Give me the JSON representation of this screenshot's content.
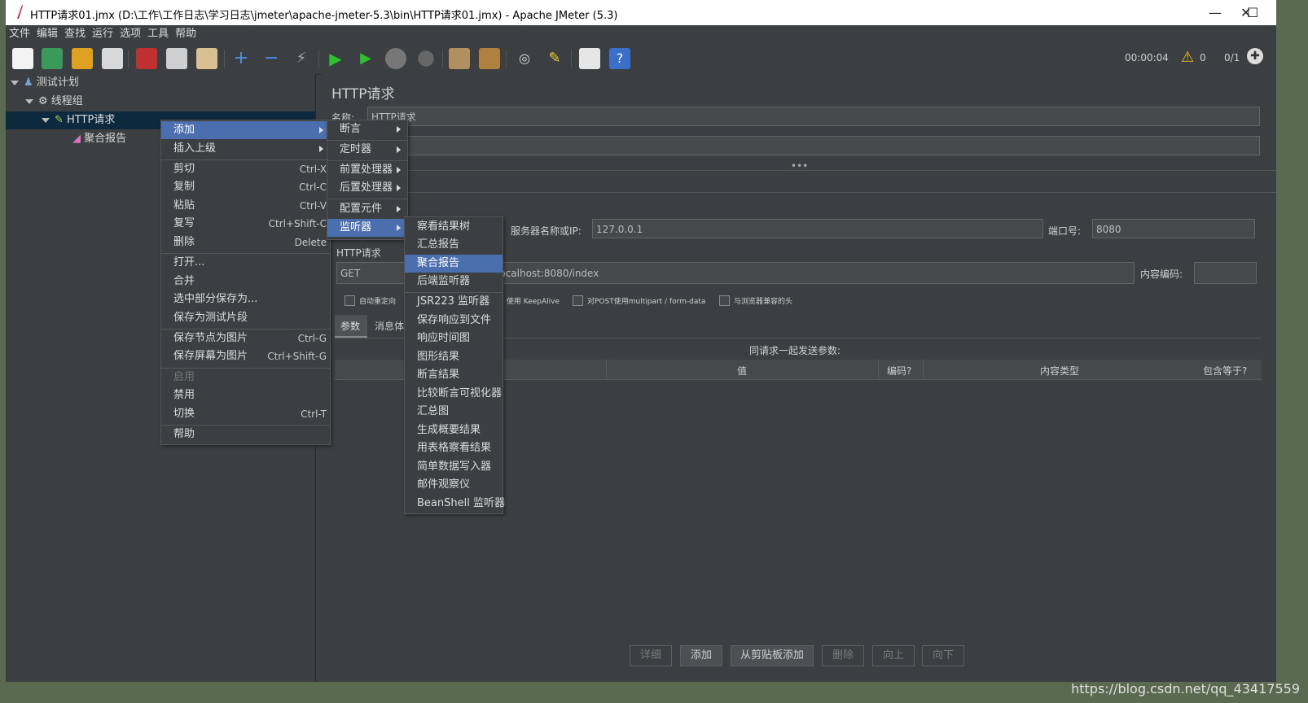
{
  "window": {
    "title": "HTTP请求01.jmx (D:\\工作\\工作日志\\学习日志\\jmeter\\apache-jmeter-5.3\\bin\\HTTP请求01.jmx) - Apache JMeter (5.3)",
    "min": "—",
    "max": "☐",
    "close": "✕"
  },
  "menubar": [
    "文件",
    "编辑",
    "查找",
    "运行",
    "选项",
    "工具",
    "帮助"
  ],
  "toolbar": {
    "timer": "00:00:04",
    "warnings": "0",
    "threads": "0/1"
  },
  "tree": {
    "items": [
      {
        "label": "测试计划"
      },
      {
        "label": "线程组"
      },
      {
        "label": "HTTP请求"
      },
      {
        "label": "聚合报告"
      }
    ]
  },
  "panel": {
    "title": "HTTP请求",
    "name_label": "名称:",
    "name_value": "HTTP请求",
    "server_label": "服务器名称或IP:",
    "server_value": "127.0.0.1",
    "port_label": "端口号:",
    "port_value": "8080",
    "http_section": "HTTP请求",
    "method": "GET",
    "path_value": "localhost:8080/index",
    "encoding_label": "内容编码:",
    "checks": [
      "自动重定向",
      "使用 KeepAlive",
      "对POST使用multipart / form-data",
      "与浏览器兼容的头"
    ],
    "tabs": [
      "参数",
      "消息体数据"
    ],
    "params_caption": "同请求一起发送参数:",
    "columns": [
      "值",
      "编码?",
      "内容类型",
      "包含等于?"
    ],
    "buttons": [
      "详细",
      "添加",
      "从剪贴板添加",
      "删除",
      "向上",
      "向下"
    ]
  },
  "context_menu": {
    "items": [
      {
        "label": "添加",
        "sub": true
      },
      {
        "label": "插入上级",
        "sub": true
      },
      {
        "label": "剪切",
        "key": "Ctrl-X"
      },
      {
        "label": "复制",
        "key": "Ctrl-C"
      },
      {
        "label": "粘贴",
        "key": "Ctrl-V"
      },
      {
        "label": "复写",
        "key": "Ctrl+Shift-C"
      },
      {
        "label": "删除",
        "key": "Delete"
      },
      {
        "label": "打开..."
      },
      {
        "label": "合并"
      },
      {
        "label": "选中部分保存为..."
      },
      {
        "label": "保存为测试片段"
      },
      {
        "label": "保存节点为图片",
        "key": "Ctrl-G"
      },
      {
        "label": "保存屏幕为图片",
        "key": "Ctrl+Shift-G"
      },
      {
        "label": "启用"
      },
      {
        "label": "禁用"
      },
      {
        "label": "切换",
        "key": "Ctrl-T"
      },
      {
        "label": "帮助"
      }
    ]
  },
  "add_submenu": [
    "断言",
    "定时器",
    "前置处理器",
    "后置处理器",
    "配置元件",
    "监听器"
  ],
  "listener_submenu": [
    "察看结果树",
    "汇总报告",
    "聚合报告",
    "后端监听器",
    "JSR223 监听器",
    "保存响应到文件",
    "响应时间图",
    "图形结果",
    "断言结果",
    "比较断言可视化器",
    "汇总图",
    "生成概要结果",
    "用表格察看结果",
    "简单数据写入器",
    "邮件观察仪",
    "BeanShell 监听器"
  ],
  "watermark": "https://blog.csdn.net/qq_43417559",
  "colors": {
    "bg": "#3c3f41",
    "highlight": "#4b6eaf",
    "tree_selected": "#0d293e"
  }
}
